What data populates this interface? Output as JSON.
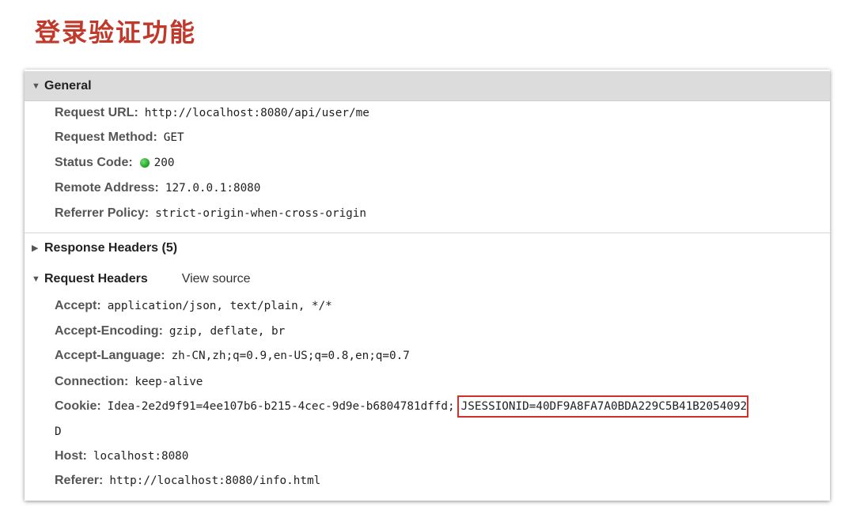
{
  "page": {
    "title": "登录验证功能"
  },
  "general": {
    "label": "General",
    "rows": [
      {
        "key": "Request URL:",
        "value": "http://localhost:8080/api/user/me"
      },
      {
        "key": "Request Method:",
        "value": "GET"
      },
      {
        "key": "Status Code:",
        "value": "200"
      },
      {
        "key": "Remote Address:",
        "value": "127.0.0.1:8080"
      },
      {
        "key": "Referrer Policy:",
        "value": "strict-origin-when-cross-origin"
      }
    ]
  },
  "response_headers": {
    "label": "Response Headers (5)"
  },
  "request_headers": {
    "label": "Request Headers",
    "view_source": "View source",
    "rows": [
      {
        "key": "Accept:",
        "value": "application/json, text/plain, */*"
      },
      {
        "key": "Accept-Encoding:",
        "value": "gzip, deflate, br"
      },
      {
        "key": "Accept-Language:",
        "value": "zh-CN,zh;q=0.9,en-US;q=0.8,en;q=0.7"
      },
      {
        "key": "Connection:",
        "value": "keep-alive"
      },
      {
        "key": "Cookie:",
        "value": "Idea-2e2d9f91=4ee107b6-b215-4cec-9d9e-b6804781dffd;",
        "highlight": "JSESSIONID=40DF9A8FA7A0BDA229C5B41B2054092",
        "wrap": "D"
      },
      {
        "key": "Host:",
        "value": "localhost:8080"
      },
      {
        "key": "Referer:",
        "value": "http://localhost:8080/info.html"
      }
    ]
  },
  "colors": {
    "title": "#c0392b",
    "highlight_border": "#d0312d",
    "status_ok": "#1f9d1f",
    "header_bg": "#dcdcdc"
  },
  "icons": {
    "expanded": "triangle-down-icon",
    "collapsed": "triangle-right-icon",
    "status": "green-dot-icon"
  }
}
